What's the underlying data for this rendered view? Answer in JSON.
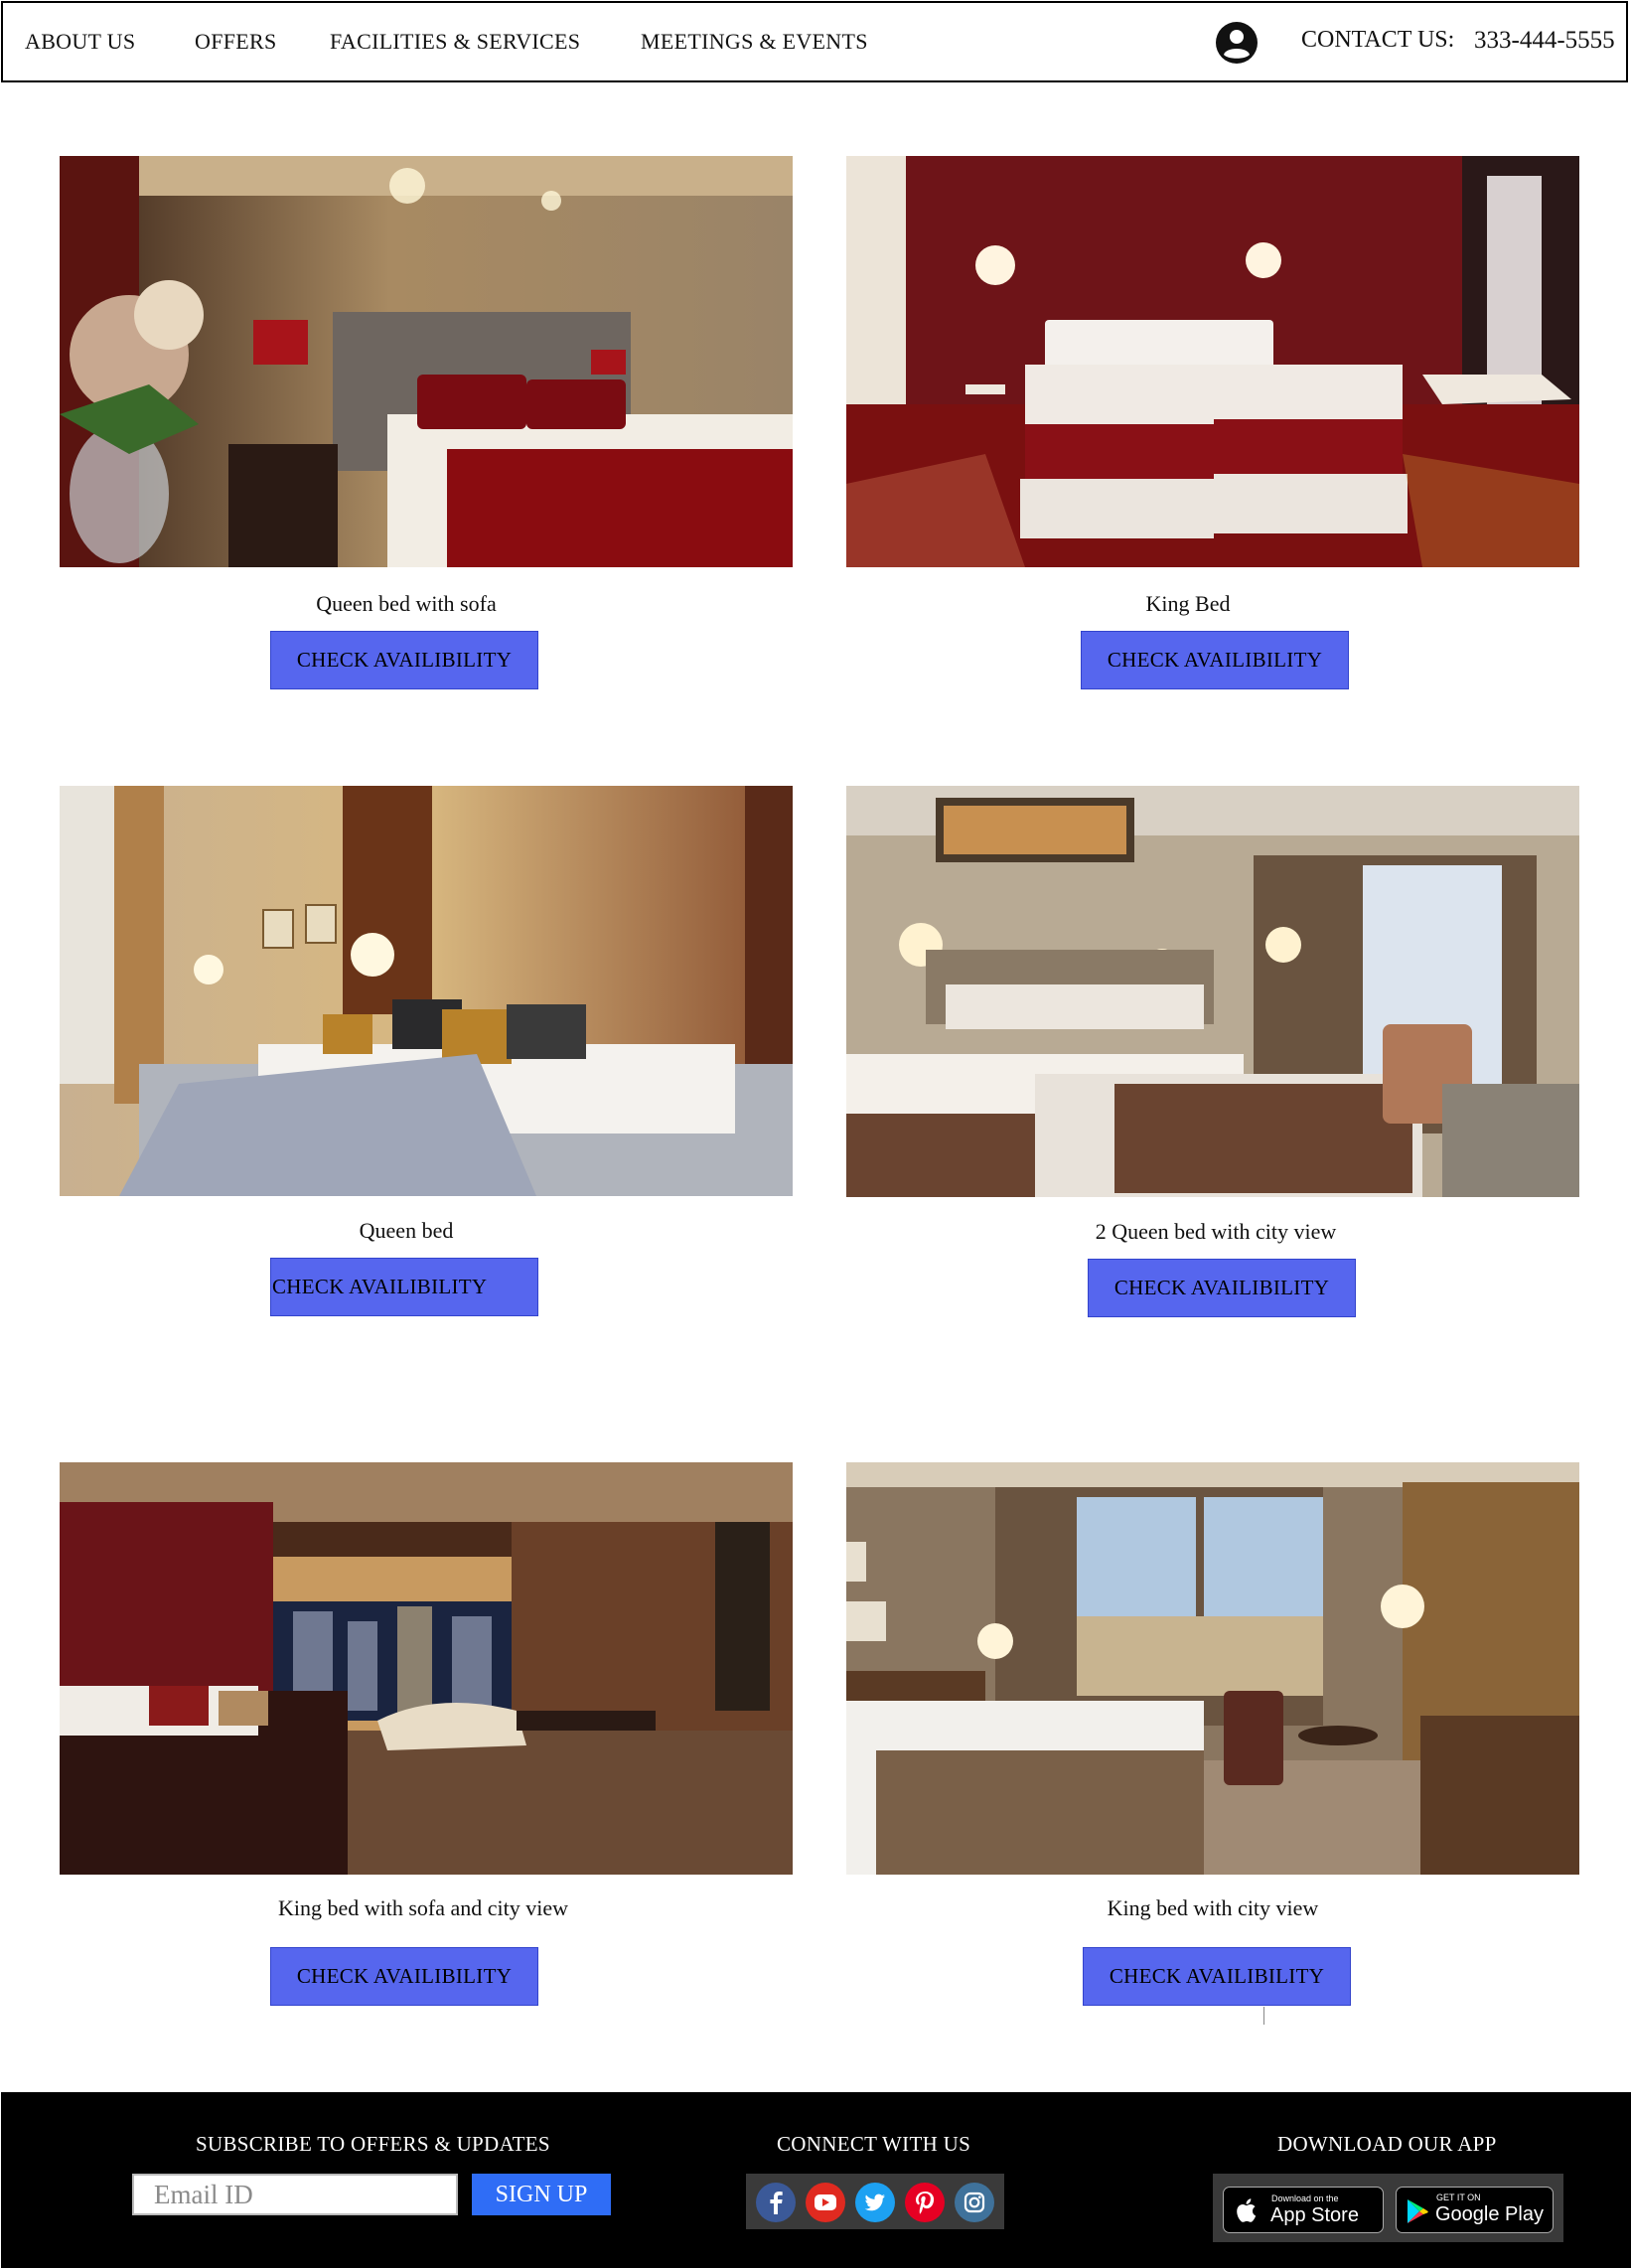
{
  "nav": {
    "items": [
      "ABOUT US",
      "OFFERS",
      "FACILITIES & SERVICES",
      "MEETINGS & EVENTS"
    ],
    "contact_label": "CONTACT US:",
    "contact_phone": "333-444-5555"
  },
  "rooms": [
    {
      "name": "Queen bed with sofa",
      "button": "CHECK AVAILIBILITY"
    },
    {
      "name": "King Bed",
      "button": "CHECK AVAILIBILITY"
    },
    {
      "name": "Queen bed",
      "button": "CHECK AVAILIBILITY"
    },
    {
      "name": "2 Queen bed with city view",
      "button": "CHECK AVAILIBILITY"
    },
    {
      "name": "King bed with sofa and city view",
      "button": "CHECK AVAILIBILITY"
    },
    {
      "name": "King bed with city view",
      "button": "CHECK AVAILIBILITY"
    }
  ],
  "footer": {
    "subscribe_heading": "SUBSCRIBE TO OFFERS & UPDATES",
    "email_placeholder": "Email ID",
    "signup_label": "SIGN UP",
    "connect_heading": "CONNECT WITH US",
    "social": [
      "facebook-icon",
      "youtube-icon",
      "twitter-icon",
      "pinterest-icon",
      "instagram-icon"
    ],
    "app_heading": "DOWNLOAD OUR APP",
    "app_store_small": "Download on the",
    "app_store_big": "App Store",
    "google_play_small": "GET IT ON",
    "google_play_big": "Google Play"
  },
  "colors": {
    "button_bg": "#5666ee",
    "signup_bg": "#2f6df6",
    "footer_bg": "#000000",
    "facebook": "#3b5998",
    "youtube": "#e02a20",
    "twitter": "#1da1f2",
    "pinterest": "#e60023",
    "instagram": "#3f729b"
  }
}
